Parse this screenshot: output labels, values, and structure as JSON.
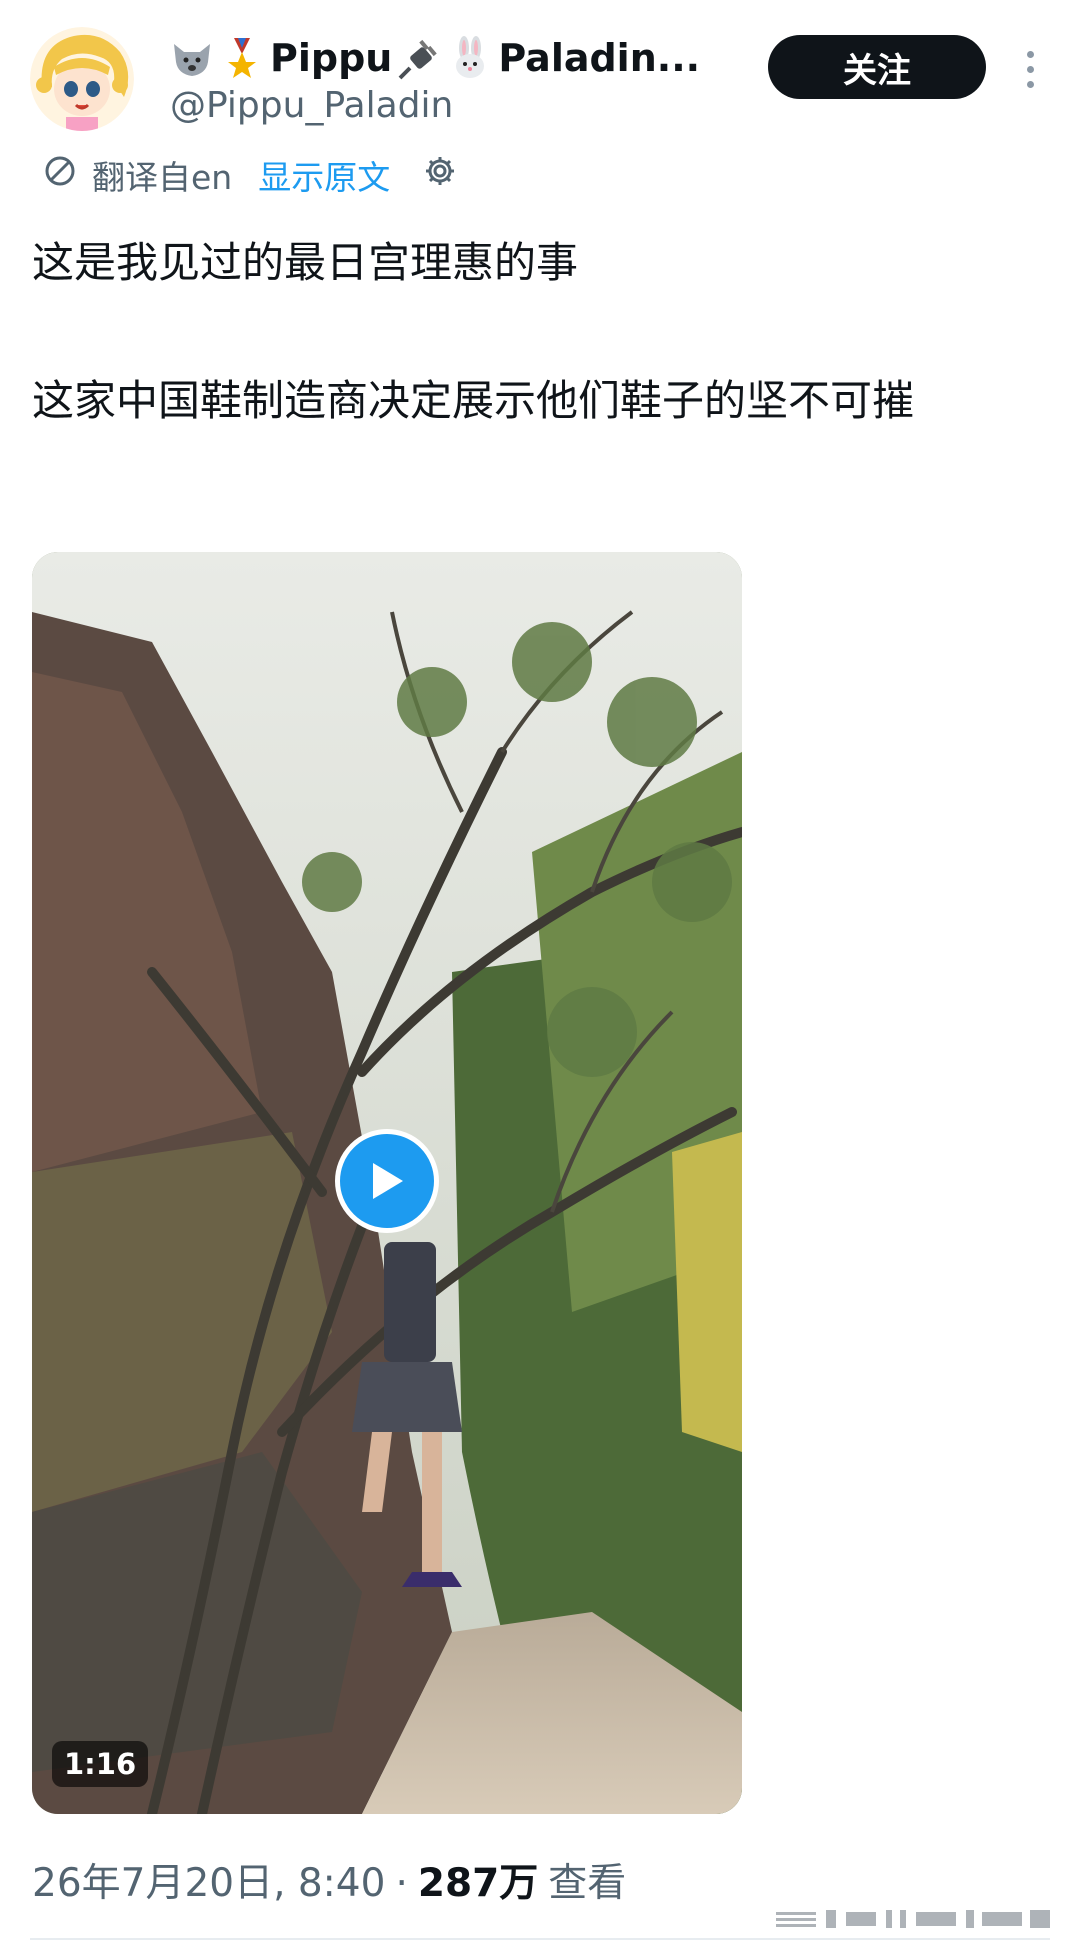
{
  "author": {
    "display_name": "Pippu",
    "display_name_tail": "Paladin...",
    "handle": "@Pippu_Paladin",
    "name_emojis": [
      "wolf-icon",
      "medal-icon",
      "plug-icon",
      "rabbit-icon"
    ]
  },
  "follow_label": "关注",
  "translation": {
    "label": "翻译自en",
    "show_original": "显示原文",
    "icon": "translate-icon",
    "settings_icon": "gear-icon"
  },
  "tweet": {
    "line1": "这是我见过的最日宫理惠的事",
    "line2": "这家中国鞋制造商决定展示他们鞋子的坚不可摧"
  },
  "media": {
    "type": "video",
    "duration": "1:16",
    "play_icon": "play-icon"
  },
  "meta": {
    "date_time": "26年7月20日, 8:40",
    "separator": "·",
    "views_count": "287万",
    "views_label": "查看"
  },
  "colors": {
    "accent": "#1d9bf0",
    "text_primary": "#0f1419",
    "text_secondary": "#536471",
    "follow_bg": "#0f1419"
  }
}
